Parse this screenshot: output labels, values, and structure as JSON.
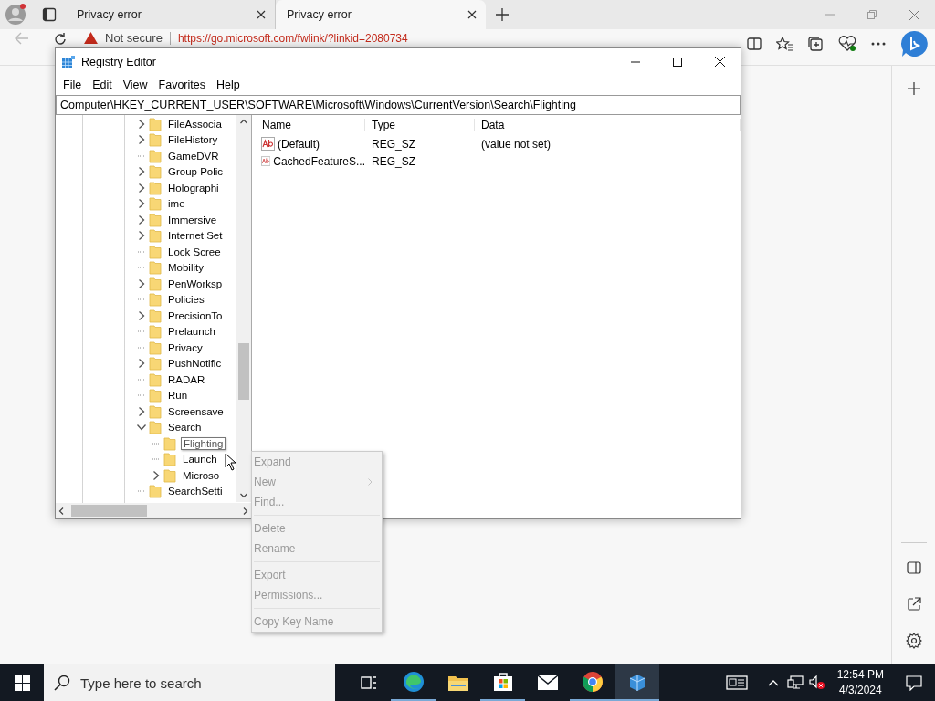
{
  "browser": {
    "tabs": [
      {
        "title": "Privacy error",
        "selected": false
      },
      {
        "title": "Privacy error",
        "selected": true
      }
    ],
    "address_bar": {
      "security_label": "Not secure",
      "url": "https://go.microsoft.com/fwlink/?linkid=2080734"
    }
  },
  "registry_editor": {
    "title": "Registry Editor",
    "menu": [
      "File",
      "Edit",
      "View",
      "Favorites",
      "Help"
    ],
    "path": "Computer\\HKEY_CURRENT_USER\\SOFTWARE\\Microsoft\\Windows\\CurrentVersion\\Search\\Flighting",
    "tree": [
      {
        "label": "FileAssocia",
        "expandable": true,
        "expanded": false,
        "selected": false
      },
      {
        "label": "FileHistory",
        "expandable": true,
        "expanded": false,
        "selected": false
      },
      {
        "label": "GameDVR",
        "expandable": false,
        "selected": false
      },
      {
        "label": "Group Polic",
        "expandable": true,
        "expanded": false,
        "selected": false
      },
      {
        "label": "Holographi",
        "expandable": true,
        "expanded": false,
        "selected": false
      },
      {
        "label": "ime",
        "expandable": true,
        "expanded": false,
        "selected": false
      },
      {
        "label": "Immersive",
        "expandable": true,
        "expanded": false,
        "selected": false
      },
      {
        "label": "Internet Set",
        "expandable": true,
        "expanded": false,
        "selected": false
      },
      {
        "label": "Lock Scree",
        "expandable": false,
        "selected": false
      },
      {
        "label": "Mobility",
        "expandable": false,
        "selected": false
      },
      {
        "label": "PenWorksp",
        "expandable": true,
        "expanded": false,
        "selected": false
      },
      {
        "label": "Policies",
        "expandable": false,
        "selected": false
      },
      {
        "label": "PrecisionTo",
        "expandable": true,
        "expanded": false,
        "selected": false
      },
      {
        "label": "Prelaunch",
        "expandable": false,
        "selected": false
      },
      {
        "label": "Privacy",
        "expandable": false,
        "selected": false
      },
      {
        "label": "PushNotific",
        "expandable": true,
        "expanded": false,
        "selected": false
      },
      {
        "label": "RADAR",
        "expandable": false,
        "selected": false
      },
      {
        "label": "Run",
        "expandable": false,
        "selected": false
      },
      {
        "label": "Screensave",
        "expandable": true,
        "expanded": false,
        "selected": false
      },
      {
        "label": "Search",
        "expandable": true,
        "expanded": true,
        "selected": false,
        "children": [
          {
            "label": "Flighting",
            "expandable": false,
            "selected": true
          },
          {
            "label": "Launch",
            "expandable": false,
            "selected": false
          },
          {
            "label": "Microso",
            "expandable": true,
            "expanded": false,
            "selected": false
          }
        ]
      },
      {
        "label": "SearchSetti",
        "expandable": false,
        "selected": false
      }
    ],
    "columns": [
      "Name",
      "Type",
      "Data"
    ],
    "values": [
      {
        "name": "(Default)",
        "type": "REG_SZ",
        "data": "(value not set)"
      },
      {
        "name": "CachedFeatureS...",
        "type": "REG_SZ"
      }
    ]
  },
  "context_menu": [
    {
      "kind": "item",
      "label": "Expand",
      "disabled": true,
      "submenu": false
    },
    {
      "kind": "item",
      "label": "New",
      "disabled": true,
      "submenu": true
    },
    {
      "kind": "item",
      "label": "Find...",
      "disabled": true,
      "submenu": false
    },
    {
      "kind": "separator"
    },
    {
      "kind": "item",
      "label": "Delete",
      "disabled": true,
      "submenu": false
    },
    {
      "kind": "item",
      "label": "Rename",
      "disabled": true,
      "submenu": false
    },
    {
      "kind": "separator"
    },
    {
      "kind": "item",
      "label": "Export",
      "disabled": true,
      "submenu": false
    },
    {
      "kind": "item",
      "label": "Permissions...",
      "disabled": true,
      "submenu": false
    },
    {
      "kind": "separator"
    },
    {
      "kind": "item",
      "label": "Copy Key Name",
      "disabled": true,
      "submenu": false
    }
  ],
  "taskbar": {
    "search": {
      "placeholder": "Type here to search"
    },
    "apps": [
      {
        "kind": "taskview",
        "running": false,
        "active": false
      },
      {
        "kind": "edge",
        "running": true,
        "active": false
      },
      {
        "kind": "files",
        "running": false,
        "active": false
      },
      {
        "kind": "store",
        "running": true,
        "active": false
      },
      {
        "kind": "mail",
        "running": false,
        "active": false
      },
      {
        "kind": "chrome",
        "running": true,
        "active": false
      },
      {
        "kind": "regedit",
        "running": true,
        "active": true
      }
    ],
    "clock": {
      "time": "12:54 PM",
      "date": "4/3/2024"
    }
  }
}
